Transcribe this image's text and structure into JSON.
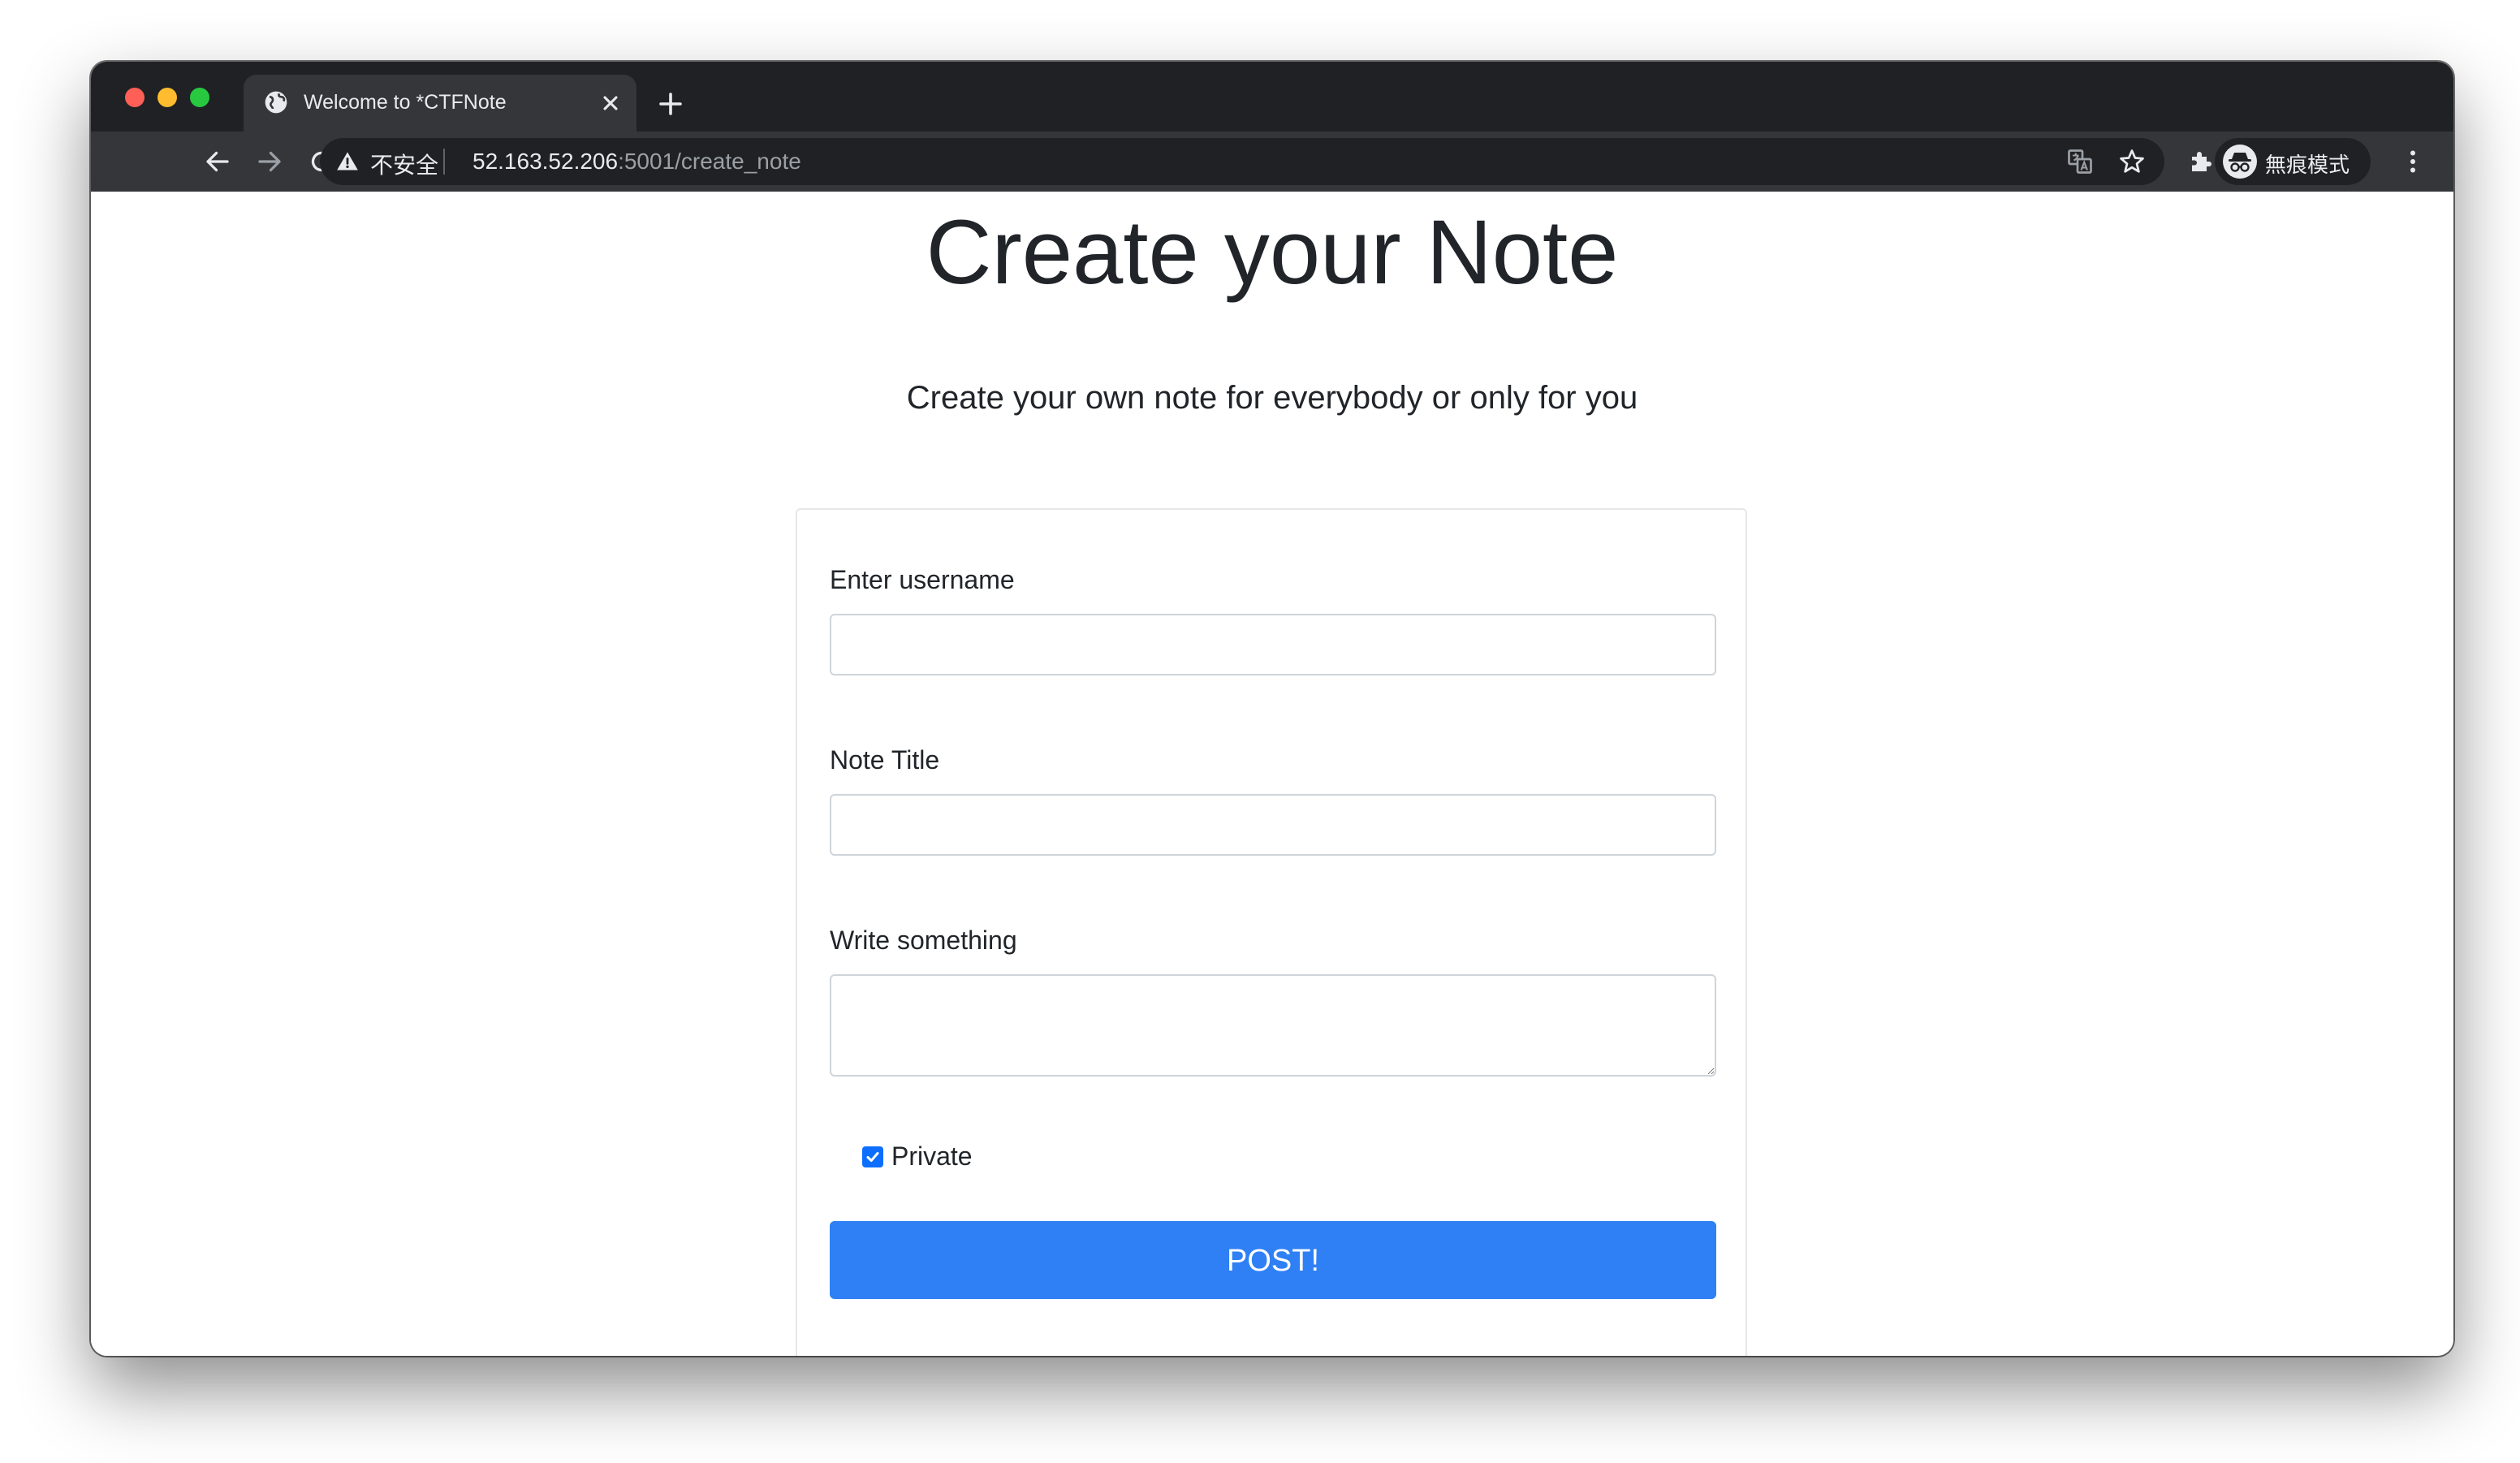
{
  "browser": {
    "tab_title": "Welcome to *CTFNote",
    "security_label": "不安全",
    "url_host": "52.163.52.206",
    "url_rest": ":5001/create_note",
    "profile_label": "無痕模式"
  },
  "page": {
    "heading": "Create your Note",
    "lead": "Create your own note for everybody or only for you"
  },
  "form": {
    "username_label": "Enter username",
    "username_value": "",
    "title_label": "Note Title",
    "title_value": "",
    "content_label": "Write something",
    "content_value": "",
    "private_label": "Private",
    "private_checked": true,
    "submit_label": "POST!"
  },
  "colors": {
    "accent": "#2f80f5",
    "checkbox": "#0d6efd"
  },
  "icons": {
    "tab": "globe-icon",
    "new_tab": "plus-icon",
    "back": "arrow-left-icon",
    "forward": "arrow-right-icon",
    "reload": "reload-icon",
    "home": "home-icon",
    "security": "warning-triangle-icon",
    "translate": "translate-icon",
    "bookmark": "star-icon",
    "extensions": "puzzle-icon",
    "profile": "incognito-icon",
    "menu": "kebab-menu-icon"
  }
}
